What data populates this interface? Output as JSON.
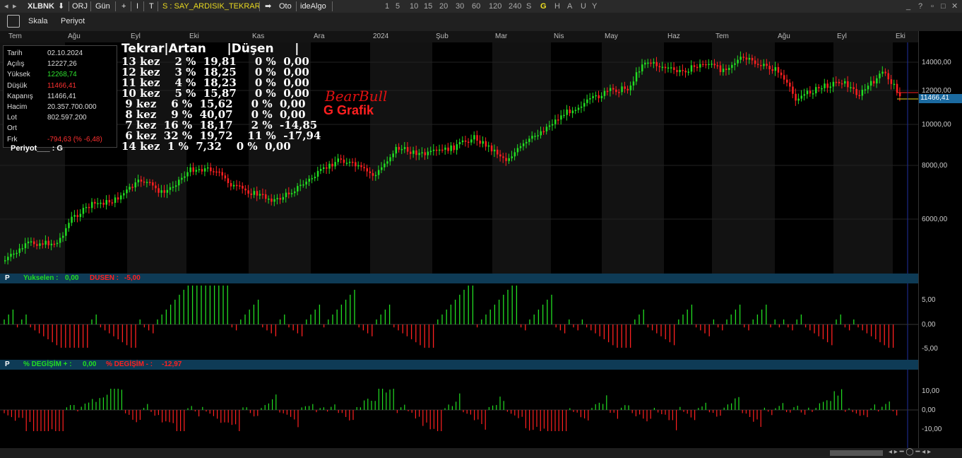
{
  "titlebar": {
    "symbol": "XLBNK",
    "items": [
      "ORJ",
      "Gün",
      "+",
      "I",
      "T"
    ],
    "strategy": "S : SAY_ARDISIK_TEKRAR",
    "mode": "Oto",
    "brand": "ideAlgo",
    "periods": [
      "1",
      "5",
      "10",
      "15",
      "20",
      "30",
      "60",
      "120",
      "240",
      "S",
      "G",
      "H",
      "A",
      "U",
      "Y"
    ],
    "active_period": "G"
  },
  "toolbar": {
    "scale": "Skala",
    "period": "Periyot"
  },
  "months": [
    "Tem",
    "Ağu",
    "Eyl",
    "Eki",
    "Kas",
    "Ara",
    "2024",
    "Şub",
    "Mar",
    "Nis",
    "May",
    "Haz",
    "Tem",
    "Ağu",
    "Eyl",
    "Eki"
  ],
  "info": {
    "rows": [
      {
        "k": "Tarih",
        "v": "02.10.2024",
        "color": "#dddddd"
      },
      {
        "k": "Açılış",
        "v": "12227,26",
        "color": "#dddddd"
      },
      {
        "k": "Yüksek",
        "v": "12268,74",
        "color": "#2ee02e"
      },
      {
        "k": "Düşük",
        "v": "11466,41",
        "color": "#ff3030"
      },
      {
        "k": "Kapanış",
        "v": "11466,41",
        "color": "#dddddd"
      },
      {
        "k": "Hacim",
        "v": "20.357.700.000",
        "color": "#dddddd"
      },
      {
        "k": "Lot",
        "v": "802.597.200",
        "color": "#dddddd"
      },
      {
        "k": "Ort",
        "v": "",
        "color": "#dddddd"
      },
      {
        "k": "Frk",
        "v": "-794,63 (% -6,48)",
        "color": "#ff3030"
      }
    ],
    "period_label": "Periyot___ : G"
  },
  "stats": {
    "header": "Tekrar|Artan     |Düşen     |",
    "lines": [
      "13 kez    2 %  19,81     0 %  0,00",
      "12 kez    3 %  18,25     0 %  0,00",
      "11 kez    4 %  18,23     0 %  0,00",
      "10 kez    5 %  15,87     0 %  0,00",
      " 9 kez    6 %  15,62     0 %  0,00",
      " 8 kez    9 %  40,07     0 %  0,00",
      " 7 kez  16 %  18,17     2 %  -14,85",
      " 6 kez  32 %  19,72    11 %  -17,94",
      "14 kez  1 %  7,32    0 %  0,00"
    ]
  },
  "logo": {
    "line1": "BearBull",
    "line2": "G  Grafik"
  },
  "price_axis": {
    "labels": [
      "14000,00",
      "12000,00",
      "10000,00",
      "8000,00",
      "6000,00"
    ],
    "last_price": "11466,41"
  },
  "panel1": {
    "prefix": "P",
    "up_label": "Yukselen :",
    "up_value": "0,00",
    "down_label": "DUSEN :",
    "down_value": "-5,00",
    "ticks": [
      "5,00",
      "0,00",
      "-5,00"
    ]
  },
  "panel2": {
    "prefix": "P",
    "up_label": "% DEGİŞİM + :",
    "up_value": "0,00",
    "down_label": "% DEGİŞİM - :",
    "down_value": "-12,97",
    "ticks": [
      "10,00",
      "0,00",
      "-10,00"
    ]
  },
  "colors": {
    "up": "#22dd22",
    "down": "#ff2020",
    "panel_header": "#0e3b56"
  }
}
